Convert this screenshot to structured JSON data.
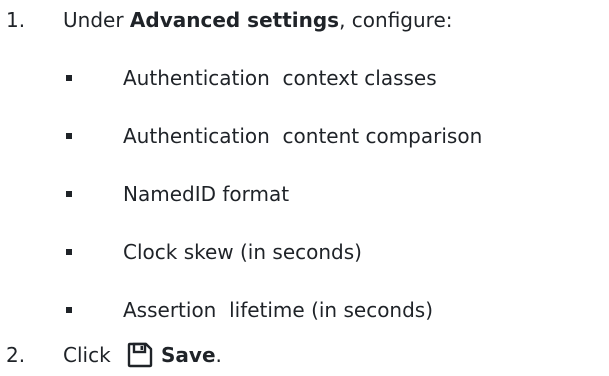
{
  "steps": [
    {
      "number": "1.",
      "prefix": "Under ",
      "bold": "Advanced settings",
      "suffix": ", configure:",
      "items": [
        "Authentication  context classes",
        "Authentication  content comparison",
        "NamedID format",
        "Clock skew (in seconds)",
        "Assertion  lifetime (in seconds)"
      ]
    },
    {
      "number": "2.",
      "prefix": "Click ",
      "icon": "save-icon",
      "bold": "Save",
      "suffix": "."
    }
  ]
}
